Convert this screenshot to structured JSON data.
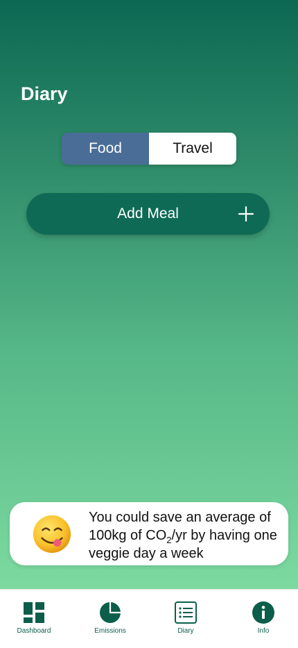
{
  "header": {
    "title": "Diary"
  },
  "segments": {
    "food": "Food",
    "travel": "Travel",
    "selected": "Food"
  },
  "add_meal": {
    "label": "Add Meal"
  },
  "tip": {
    "emoji": "yum-face-emoji",
    "text_part1": "You could save an average of 100kg of CO",
    "subscript": "2",
    "text_part2": "/yr by having one veggie day a week"
  },
  "tabbar": {
    "items": [
      {
        "label": "Dashboard",
        "icon": "dashboard-icon"
      },
      {
        "label": "Emissions",
        "icon": "pie-chart-icon"
      },
      {
        "label": "Diary",
        "icon": "list-icon"
      },
      {
        "label": "Info",
        "icon": "info-icon"
      }
    ]
  },
  "colors": {
    "gradient_top": "#0c6852",
    "gradient_bottom": "#86e3a6",
    "accent_dark": "#0e6a55",
    "segment_active": "#4a6d97"
  }
}
